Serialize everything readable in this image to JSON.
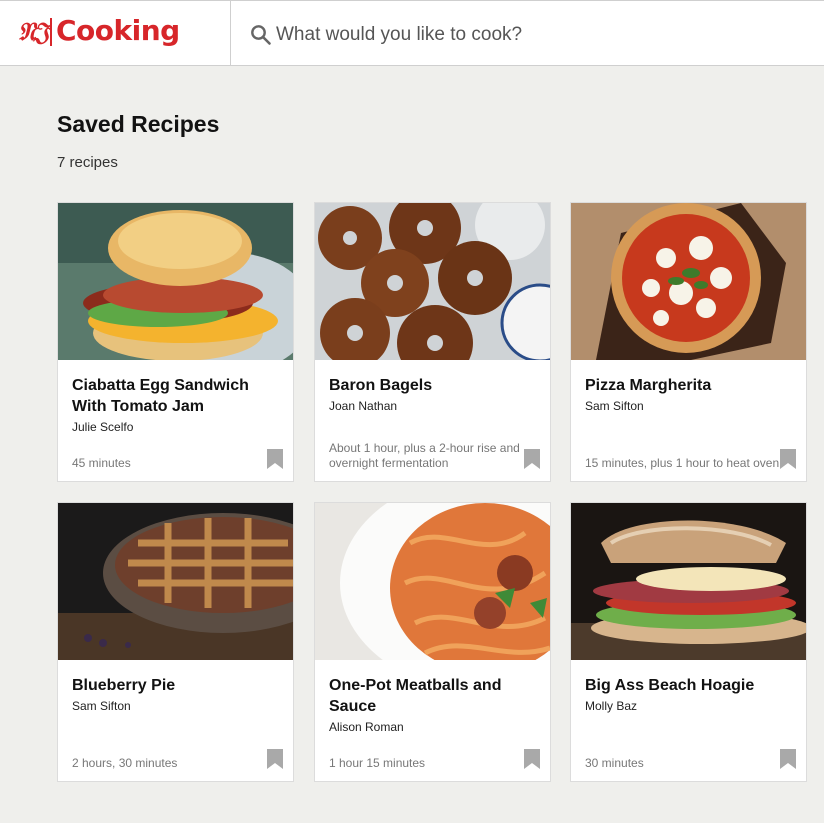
{
  "header": {
    "logo_mark": "𝔑𝔍",
    "logo_text": "Cooking",
    "search_placeholder": "What would you like to cook?"
  },
  "main": {
    "title": "Saved Recipes",
    "count": "7 recipes"
  },
  "recipes": [
    {
      "title": "Ciabatta Egg Sandwich With Tomato Jam",
      "author": "Julie Scelfo",
      "time": "45 minutes"
    },
    {
      "title": "Baron Bagels",
      "author": "Joan Nathan",
      "time": "About 1 hour, plus a 2-hour rise and overnight fermentation"
    },
    {
      "title": "Pizza Margherita",
      "author": "Sam Sifton",
      "time": "15 minutes, plus 1 hour to heat oven"
    },
    {
      "title": "Blueberry Pie",
      "author": "Sam Sifton",
      "time": "2 hours, 30 minutes"
    },
    {
      "title": "One-Pot Meatballs and Sauce",
      "author": "Alison Roman",
      "time": "1 hour 15 minutes"
    },
    {
      "title": "Big Ass Beach Hoagie",
      "author": "Molly Baz",
      "time": "30 minutes"
    }
  ],
  "colors": {
    "brand_red": "#d7262a",
    "page_bg": "#efefec",
    "bookmark_gray": "#a9a9a9"
  },
  "icons": {
    "search": "search-icon",
    "bookmark": "bookmark-icon"
  }
}
